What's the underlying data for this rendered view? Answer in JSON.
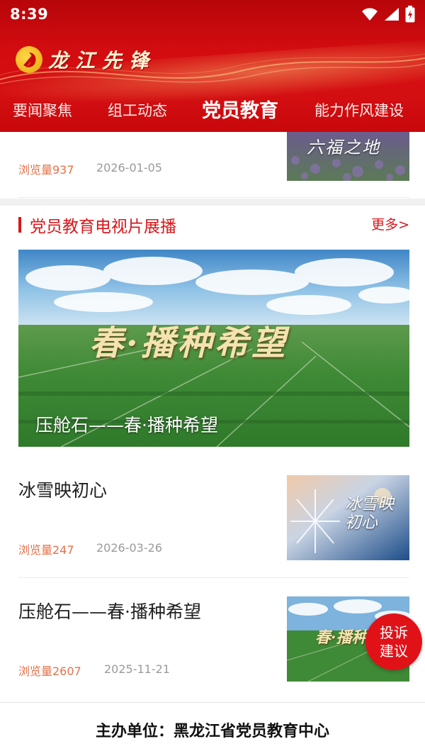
{
  "status_bar": {
    "time": "8:39",
    "icons": [
      "wifi-icon",
      "signal-icon",
      "battery-icon"
    ]
  },
  "header": {
    "brand_title": "龙江先锋",
    "emblem": "party-emblem-icon",
    "tabs": [
      {
        "label": "要闻聚焦",
        "active": false
      },
      {
        "label": "组工动态",
        "active": false
      },
      {
        "label": "党员教育",
        "active": true
      },
      {
        "label": "能力作风建设",
        "active": false
      }
    ]
  },
  "top_item": {
    "views": "浏览量937",
    "date": "2026-01-05",
    "thumb_text": "六福之地"
  },
  "section": {
    "title": "党员教育电视片展播",
    "more": "更多>"
  },
  "feature": {
    "overlay_title": "春·播种希望",
    "caption": "压舱石——春·播种希望"
  },
  "news": [
    {
      "title": "冰雪映初心",
      "views": "浏览量247",
      "date": "2026-03-26",
      "thumb_text": "冰雪映初心"
    },
    {
      "title": "压舱石——春·播种希望",
      "views": "浏览量2607",
      "date": "2025-11-21",
      "thumb_text": "春·播种"
    }
  ],
  "float_button": {
    "line1": "投诉",
    "line2": "建议"
  },
  "footer": {
    "text": "主办单位：黑龙江省党员教育中心"
  },
  "colors": {
    "brand_red": "#d30c10",
    "accent_red": "#d8171b",
    "views_orange": "#e5714a",
    "date_gray": "#9a9a9a"
  }
}
